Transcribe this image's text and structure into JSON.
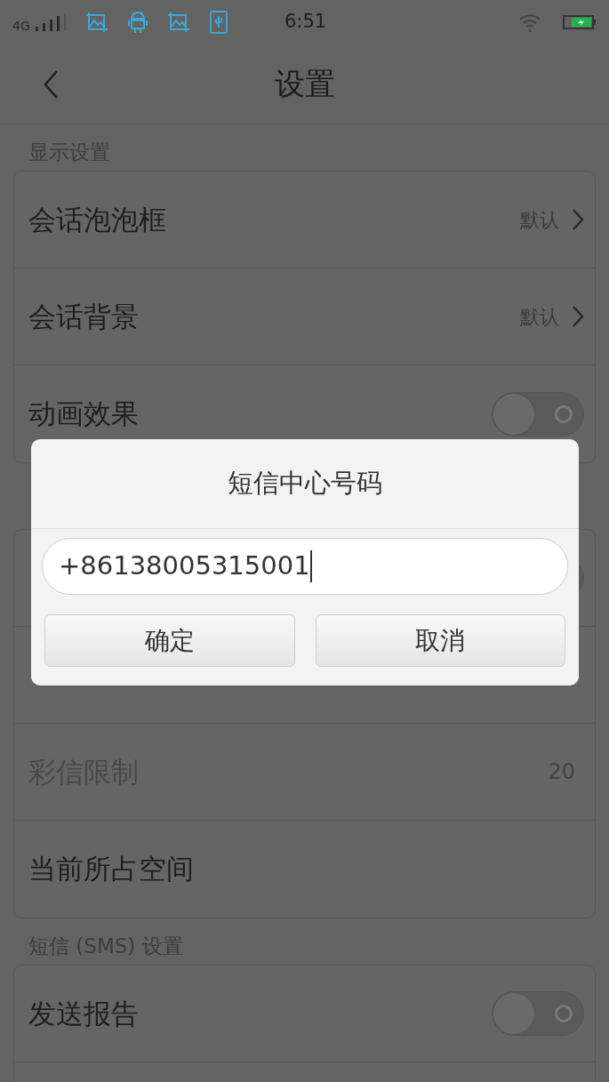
{
  "status_bar": {
    "network": "4G",
    "time": "6:51"
  },
  "header": {
    "title": "设置"
  },
  "sections": [
    {
      "label": "显示设置",
      "rows": [
        {
          "kind": "link",
          "label": "会话泡泡框",
          "value": "默认"
        },
        {
          "kind": "link",
          "label": "会话背景",
          "value": "默认"
        },
        {
          "kind": "toggle",
          "label": "动画效果",
          "on": false
        }
      ]
    },
    {
      "rows": [
        {
          "kind": "toggle",
          "on": false
        },
        {
          "kind": "plain"
        },
        {
          "kind": "value",
          "label": "彩信限制",
          "value": "20",
          "disabled": true
        },
        {
          "kind": "plain",
          "label": "当前所占空间"
        }
      ]
    },
    {
      "label": "短信 (SMS) 设置",
      "rows": [
        {
          "kind": "toggle",
          "label": "发送报告",
          "on": false
        },
        {
          "kind": "plain"
        }
      ]
    }
  ],
  "dialog": {
    "title": "短信中心号码",
    "input_value": "+86138005315001",
    "buttons": [
      "确定",
      "取消"
    ]
  }
}
